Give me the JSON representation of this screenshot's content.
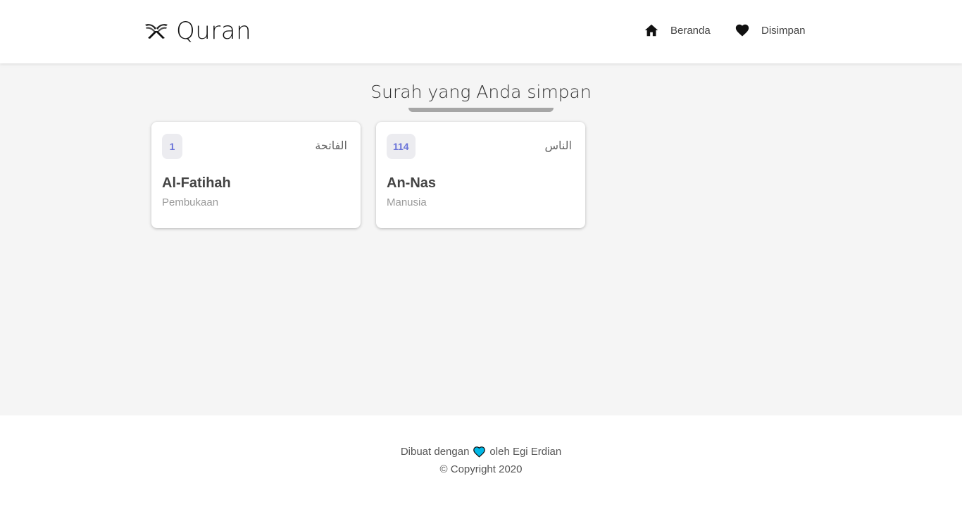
{
  "header": {
    "brand_icon": "quran-book-icon",
    "brand_title": "Quran",
    "nav": [
      {
        "label": "Beranda",
        "icon": "home-icon"
      },
      {
        "label": "Disimpan",
        "icon": "heart-icon"
      }
    ]
  },
  "main": {
    "title": "Surah yang Anda simpan",
    "cards": [
      {
        "number": "1",
        "arabic": "الفاتحة",
        "name": "Al-Fatihah",
        "meaning": "Pembukaan"
      },
      {
        "number": "114",
        "arabic": "الناس",
        "name": "An-Nas",
        "meaning": "Manusia"
      }
    ]
  },
  "footer": {
    "made_with": "Dibuat dengan",
    "heart_icon": "heart-icon",
    "heart_color": "#00b8e6",
    "by": "oleh Egi Erdian",
    "copyright": "© Copyright 2020"
  },
  "colors": {
    "badge_text": "#6a73d8",
    "background": "#f5f5f5"
  }
}
